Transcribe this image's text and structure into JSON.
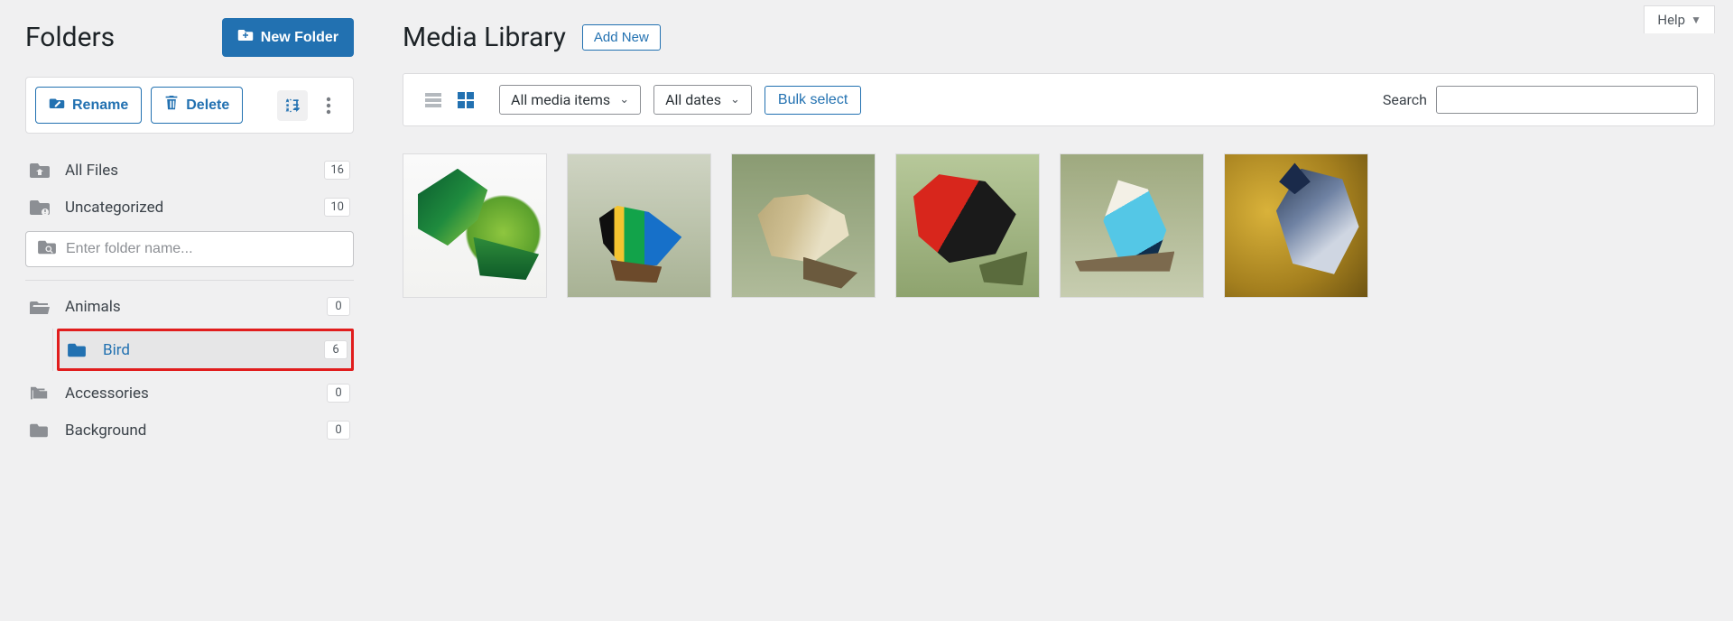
{
  "sidebar": {
    "title": "Folders",
    "new_folder_label": "New Folder",
    "rename_label": "Rename",
    "delete_label": "Delete",
    "fixed": [
      {
        "label": "All Files",
        "count": "16"
      },
      {
        "label": "Uncategorized",
        "count": "10"
      }
    ],
    "search_placeholder": "Enter folder name...",
    "tree": {
      "animals": {
        "label": "Animals",
        "count": "0"
      },
      "bird": {
        "label": "Bird",
        "count": "6"
      },
      "accessories": {
        "label": "Accessories",
        "count": "0"
      },
      "background": {
        "label": "Background",
        "count": "0"
      }
    }
  },
  "main": {
    "help_label": "Help",
    "page_title": "Media Library",
    "add_new_label": "Add New",
    "filter": {
      "media_items": "All media items",
      "dates": "All dates",
      "bulk_select": "Bulk select",
      "search_label": "Search"
    },
    "thumbs": [
      "bird-green-parrot",
      "bird-colorful-tanager",
      "bird-warbler",
      "bird-scarlet-tanager",
      "bird-budgerigar",
      "bird-blue-jay"
    ]
  }
}
